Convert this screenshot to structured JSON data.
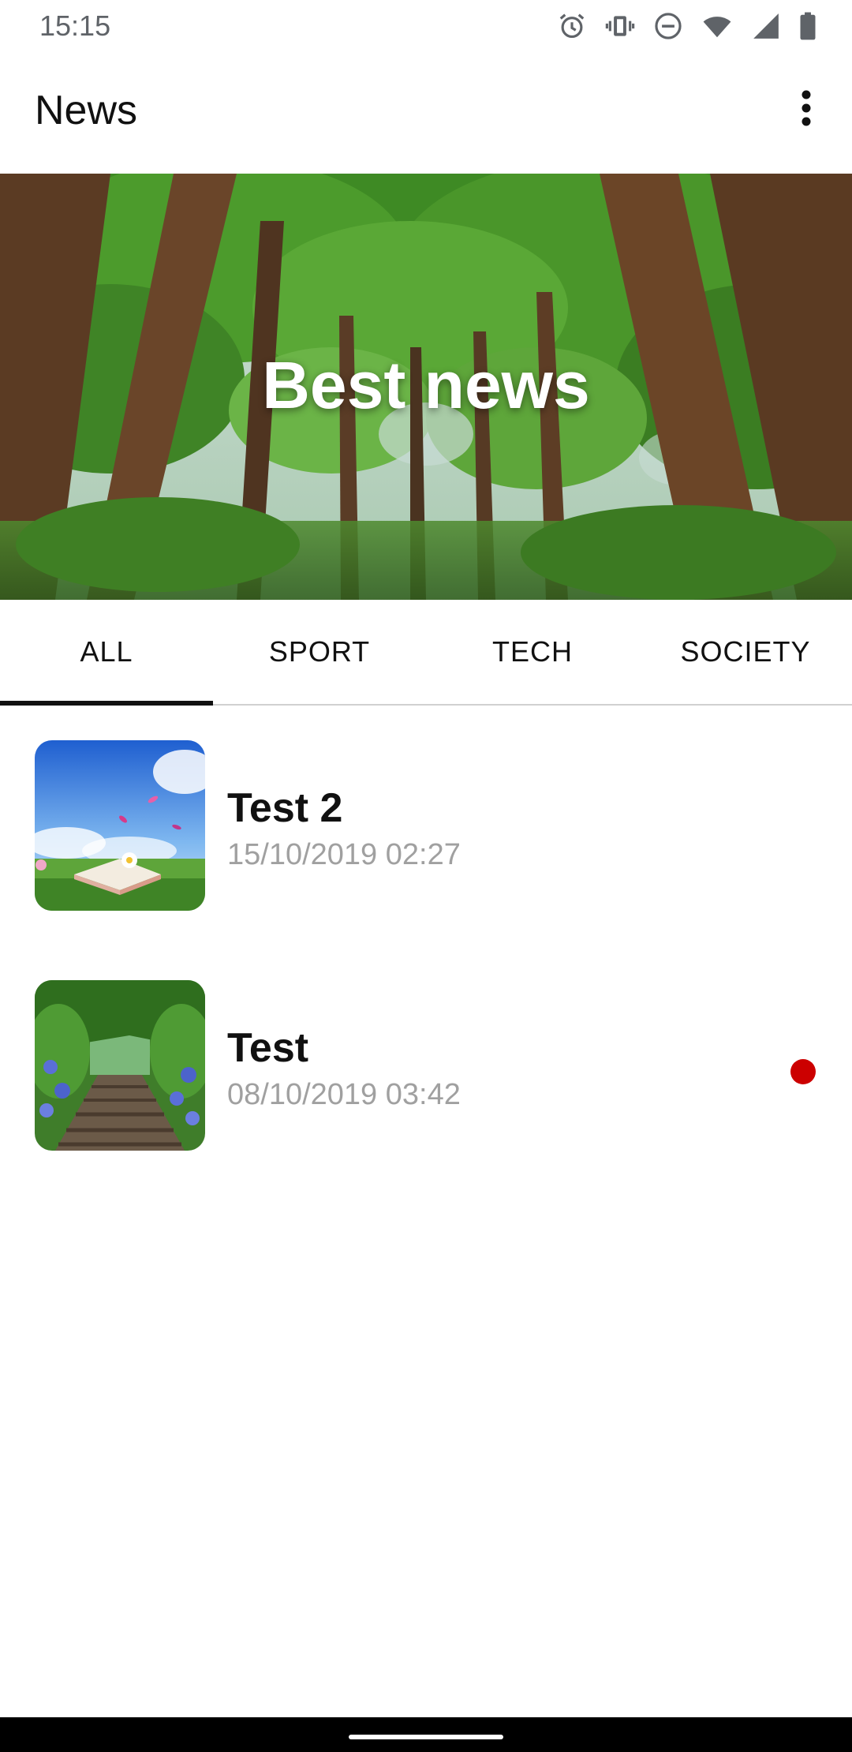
{
  "status_bar": {
    "time": "15:15",
    "icons": [
      "alarm-icon",
      "vibrate-icon",
      "do-not-disturb-icon",
      "wifi-icon",
      "signal-icon",
      "battery-icon"
    ]
  },
  "app_bar": {
    "title": "News",
    "overflow_icon": "more-vert-icon"
  },
  "hero": {
    "title": "Best news"
  },
  "tabs": [
    {
      "label": "ALL",
      "active": true
    },
    {
      "label": "SPORT",
      "active": false
    },
    {
      "label": "TECH",
      "active": false
    },
    {
      "label": "SOCIETY",
      "active": false
    }
  ],
  "news": [
    {
      "title": "Test 2",
      "date": "15/10/2019 02:27",
      "unread": false
    },
    {
      "title": "Test",
      "date": "08/10/2019 03:42",
      "unread": true
    }
  ],
  "colors": {
    "accent": "#111111",
    "unread_dot": "#cc0000",
    "date_text": "#a0a0a0"
  }
}
